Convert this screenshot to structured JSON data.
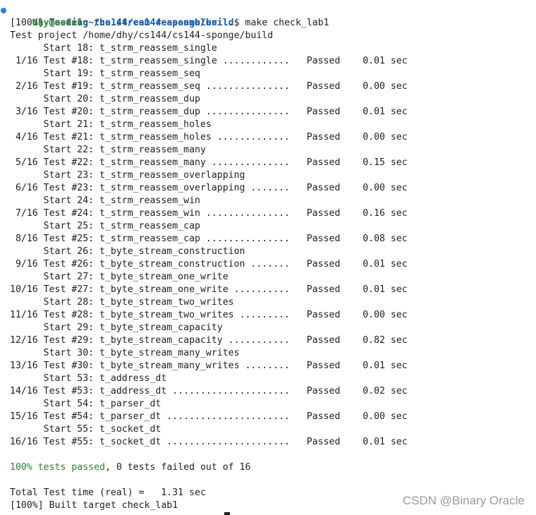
{
  "prompt": {
    "user_host": "dhy@node1",
    "separator": ":",
    "path": "~/cs144/cs144-sponge/build",
    "symbol": "$",
    "command": " make check_lab1"
  },
  "header": {
    "progress_tag": "[100%]",
    "testing_msg": "Testing the stream reassembler...",
    "project_line": "Test project /home/dhy/cs144/cs144-sponge/build"
  },
  "tests": [
    {
      "start": "      Start 18: t_strm_reassem_single",
      "result": " 1/16 Test #18: t_strm_reassem_single ............   Passed    0.01 sec"
    },
    {
      "start": "      Start 19: t_strm_reassem_seq",
      "result": " 2/16 Test #19: t_strm_reassem_seq ...............   Passed    0.00 sec"
    },
    {
      "start": "      Start 20: t_strm_reassem_dup",
      "result": " 3/16 Test #20: t_strm_reassem_dup ...............   Passed    0.01 sec"
    },
    {
      "start": "      Start 21: t_strm_reassem_holes",
      "result": " 4/16 Test #21: t_strm_reassem_holes .............   Passed    0.00 sec"
    },
    {
      "start": "      Start 22: t_strm_reassem_many",
      "result": " 5/16 Test #22: t_strm_reassem_many ..............   Passed    0.15 sec"
    },
    {
      "start": "      Start 23: t_strm_reassem_overlapping",
      "result": " 6/16 Test #23: t_strm_reassem_overlapping .......   Passed    0.00 sec"
    },
    {
      "start": "      Start 24: t_strm_reassem_win",
      "result": " 7/16 Test #24: t_strm_reassem_win ...............   Passed    0.16 sec"
    },
    {
      "start": "      Start 25: t_strm_reassem_cap",
      "result": " 8/16 Test #25: t_strm_reassem_cap ...............   Passed    0.08 sec"
    },
    {
      "start": "      Start 26: t_byte_stream_construction",
      "result": " 9/16 Test #26: t_byte_stream_construction .......   Passed    0.01 sec"
    },
    {
      "start": "      Start 27: t_byte_stream_one_write",
      "result": "10/16 Test #27: t_byte_stream_one_write ..........   Passed    0.01 sec"
    },
    {
      "start": "      Start 28: t_byte_stream_two_writes",
      "result": "11/16 Test #28: t_byte_stream_two_writes .........   Passed    0.00 sec"
    },
    {
      "start": "      Start 29: t_byte_stream_capacity",
      "result": "12/16 Test #29: t_byte_stream_capacity ...........   Passed    0.82 sec"
    },
    {
      "start": "      Start 30: t_byte_stream_many_writes",
      "result": "13/16 Test #30: t_byte_stream_many_writes ........   Passed    0.01 sec"
    },
    {
      "start": "      Start 53: t_address_dt",
      "result": "14/16 Test #53: t_address_dt .....................   Passed    0.02 sec"
    },
    {
      "start": "      Start 54: t_parser_dt",
      "result": "15/16 Test #54: t_parser_dt ......................   Passed    0.00 sec"
    },
    {
      "start": "      Start 55: t_socket_dt",
      "result": "16/16 Test #55: t_socket_dt ......................   Passed    0.01 sec"
    }
  ],
  "summary": {
    "passed": "100% tests passed",
    "rest": ", 0 tests failed out of 16",
    "total_time": "Total Test time (real) =   1.31 sec",
    "built": "[100%] Built target check_lab1"
  },
  "watermark": "CSDN @Binary Oracle",
  "colors": {
    "prompt_user": "#2e7d32",
    "prompt_path": "#1c5ea8",
    "pass_summary": "#2e7d32",
    "background": "#ffffff"
  },
  "icons": {
    "prompt_indicator": "dot-icon"
  }
}
